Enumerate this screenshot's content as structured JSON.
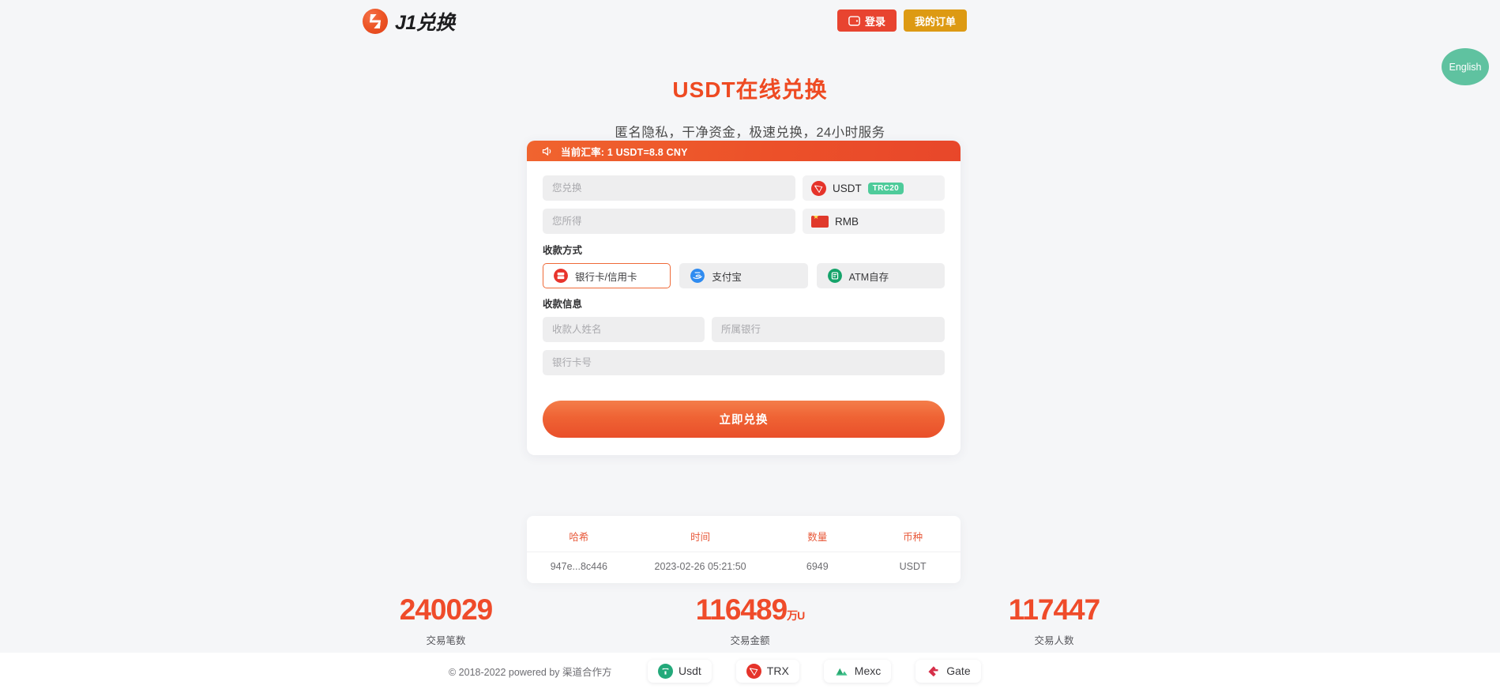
{
  "header": {
    "logo_text": "J1兑换",
    "login_label": "登录",
    "orders_label": "我的订单"
  },
  "language_toggle": {
    "label": "English"
  },
  "hero": {
    "title": "USDT在线兑换",
    "subtitle": "匿名隐私，干净资金，极速兑换，24小时服务"
  },
  "exchange_card": {
    "notice": "当前汇率: 1 USDT=8.8 CNY",
    "pay_amount": {
      "placeholder": "您兑换",
      "value": ""
    },
    "pay_asset": {
      "name": "USDT",
      "network_badge": "TRC20"
    },
    "receive_amount": {
      "placeholder": "您所得",
      "value": ""
    },
    "receive_asset": {
      "name": "RMB"
    },
    "pay_method_label": "收款方式",
    "pay_methods": [
      {
        "label": "银行卡/信用卡",
        "selected": true
      },
      {
        "label": "支付宝",
        "selected": false
      },
      {
        "label": "ATM自存",
        "selected": false
      }
    ],
    "payee_info_label": "收款信息",
    "payee_name": {
      "placeholder": "收款人姓名",
      "value": ""
    },
    "payee_bank": {
      "placeholder": "所属银行",
      "value": ""
    },
    "payee_card": {
      "placeholder": "银行卡号",
      "value": ""
    },
    "submit_label": "立即兑换"
  },
  "transactions": {
    "columns": [
      "哈希",
      "时间",
      "数量",
      "币种"
    ],
    "rows": [
      [
        "947e...8c446",
        "2023-02-26 05:21:50",
        "6949",
        "USDT"
      ]
    ]
  },
  "stats": [
    {
      "value": "240029",
      "unit": "",
      "label": "交易笔数"
    },
    {
      "value": "116489",
      "unit": "万U",
      "label": "交易金额"
    },
    {
      "value": "117447",
      "unit": "",
      "label": "交易人数"
    }
  ],
  "footer": {
    "copyright": "© 2018-2022 powered by 渠道合作方",
    "partners": [
      {
        "name": "Usdt"
      },
      {
        "name": "TRX"
      },
      {
        "name": "Mexc"
      },
      {
        "name": "Gate"
      }
    ]
  },
  "colors": {
    "brand_orange": "#ee4a22",
    "login_red": "#e84430",
    "orders_gold": "#dd9a13",
    "badge_green": "#4ecb9a",
    "lang_green": "#5fc2a0",
    "page_bg": "#f5f6f8"
  }
}
